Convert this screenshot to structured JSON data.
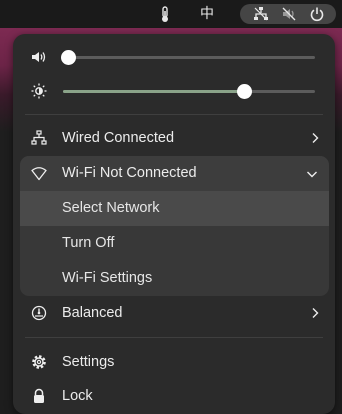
{
  "colors": {
    "menu_bg": "#2b2b2b",
    "submenu_bg": "#383838",
    "highlight": "#4a4a4a",
    "volume_fill": "#ffffff",
    "brightness_fill": "#8aa389",
    "wallpaper": "#7d2a52"
  },
  "topbar": {
    "input_method": "中",
    "icons": [
      "thermometer-icon",
      "network-wired-disconnected-icon",
      "volume-muted-icon",
      "power-icon"
    ]
  },
  "quick_settings": {
    "volume": {
      "icon": "speaker-icon",
      "level": 0.02
    },
    "brightness": {
      "icon": "brightness-icon",
      "level": 0.72
    },
    "wired": {
      "icon": "network-wired-icon",
      "label": "Wired Connected"
    },
    "wifi": {
      "icon": "wifi-icon",
      "label": "Wi-Fi Not Connected",
      "expanded": true,
      "items": [
        {
          "label": "Select Network",
          "highlighted": true
        },
        {
          "label": "Turn Off",
          "highlighted": false
        },
        {
          "label": "Wi-Fi Settings",
          "highlighted": false
        }
      ]
    },
    "power_mode": {
      "icon": "power-profile-icon",
      "label": "Balanced"
    },
    "settings": {
      "icon": "gear-icon",
      "label": "Settings"
    },
    "lock": {
      "icon": "lock-icon",
      "label": "Lock"
    }
  }
}
